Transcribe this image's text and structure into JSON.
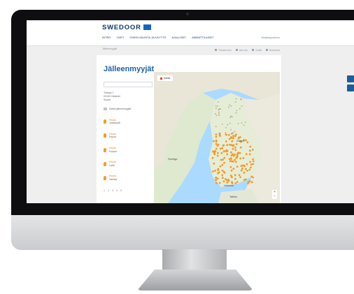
{
  "brand": {
    "name": "SWEDOOR",
    "accent": "#1565c0",
    "navy": "#0f3b66",
    "pin_color": "#f59b2d"
  },
  "header": {
    "nav": [
      "INTRO",
      "OVET",
      "OVIEN VALINTA JA KÄYTTÖ",
      "AJALLISET",
      "AMMATTILAISET"
    ],
    "user_link": "Asiakaspalvelu"
  },
  "subbar": {
    "left": "Jälleenmyyjät",
    "actions": [
      "Tulosta sivu",
      "Jaa sivu",
      "Lisää",
      "Suurenna"
    ]
  },
  "page": {
    "title": "Jälleenmyyjät"
  },
  "sidebar": {
    "address": [
      "Tiekatu 7",
      "00100 Helsinki",
      "Suomi"
    ],
    "list_header": "Kaikki jälleenmyyjät",
    "dealers": [
      {
        "name": "Rauta",
        "city": "Jyväskylä"
      },
      {
        "name": "Rauta",
        "city": "Espoo"
      },
      {
        "name": "Rauta",
        "city": "Kuopio"
      },
      {
        "name": "Rauta",
        "city": "Lahti"
      },
      {
        "name": "Rauta",
        "city": "Vantaa"
      }
    ],
    "pager": [
      "1",
      "2",
      "3",
      "4",
      "5"
    ]
  },
  "map": {
    "filter_label": "Kartta",
    "labels": {
      "finland": "Suomi",
      "sweden": "Sverige",
      "helsinki": "Helsinki",
      "tallinn": "Tallinn"
    },
    "zoom_in": "+",
    "zoom_out": "−"
  }
}
